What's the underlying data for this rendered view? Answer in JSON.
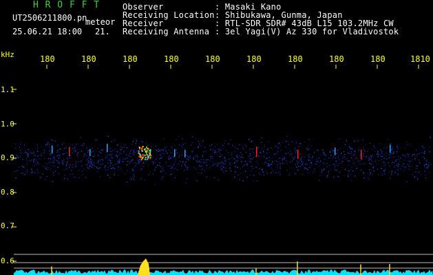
{
  "app": {
    "name": "H R O F F T",
    "file_name": "UT2506211800.pn",
    "meteor_label": "meteor",
    "date_time": "25.06.21 18:00",
    "meteor_count": "21."
  },
  "info": {
    "labels": [
      "Observer",
      "Receiving Location",
      "Receiver",
      "Receiving Antenna"
    ],
    "values": [
      ": Masaki Kano",
      ": Shibukawa, Gunma, Japan",
      ": RTL-SDR SDR# 43dB L15 103.2MHz CW",
      ": 3el Yagi(V) Az 330 for Vladivostok"
    ]
  },
  "axes": {
    "freq_unit": "kHz",
    "freq_ticks": [
      "1.1",
      "1.0",
      "0.9",
      "0.8",
      "0.7",
      "0.6"
    ],
    "time_ticks": [
      "180",
      "180",
      "180",
      "180",
      "180",
      "180",
      "180",
      "180",
      "180",
      "1810"
    ]
  },
  "colors": {
    "background": "#000000",
    "app_name": "#3bd23b",
    "header_text": "#ffffff",
    "axis_text": "#ffff33",
    "echo_hot": "#ff2020",
    "echo_warm": "#ffe020",
    "noise_band": "#1a2c9a",
    "baseline": "#00e0ff"
  }
}
